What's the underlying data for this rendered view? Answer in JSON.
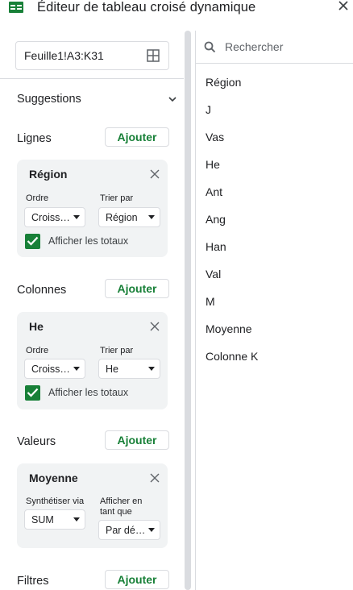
{
  "header": {
    "title": "Éditeur de tableau croisé dynamique"
  },
  "range": {
    "value": "Feuille1!A3:K31"
  },
  "suggestions": {
    "label": "Suggestions"
  },
  "rows": {
    "label": "Lignes",
    "add_label": "Ajouter",
    "card": {
      "title": "Région",
      "order_label": "Ordre",
      "order_value": "Croiss…",
      "sort_label": "Trier par",
      "sort_value": "Région",
      "totals_label": "Afficher les totaux",
      "totals_checked": true
    }
  },
  "columns": {
    "label": "Colonnes",
    "add_label": "Ajouter",
    "card": {
      "title": "He",
      "order_label": "Ordre",
      "order_value": "Croiss…",
      "sort_label": "Trier par",
      "sort_value": "He",
      "totals_label": "Afficher les totaux",
      "totals_checked": true
    }
  },
  "values": {
    "label": "Valeurs",
    "add_label": "Ajouter",
    "card": {
      "title": "Moyenne",
      "summarize_label": "Synthétiser via",
      "summarize_value": "SUM",
      "show_as_label_1": "Afficher en",
      "show_as_label_2": "tant que",
      "show_as_value": "Par dé…"
    }
  },
  "filters": {
    "label": "Filtres",
    "add_label": "Ajouter"
  },
  "search": {
    "placeholder": "Rechercher"
  },
  "fields": [
    "Région",
    "J",
    "Vas",
    "He",
    "Ant",
    "Ang",
    "Han",
    "Val",
    "M",
    "Moyenne",
    "Colonne K"
  ],
  "colors": {
    "accent": "#188038",
    "border": "#dadce0",
    "card_bg": "#f1f3f4"
  }
}
